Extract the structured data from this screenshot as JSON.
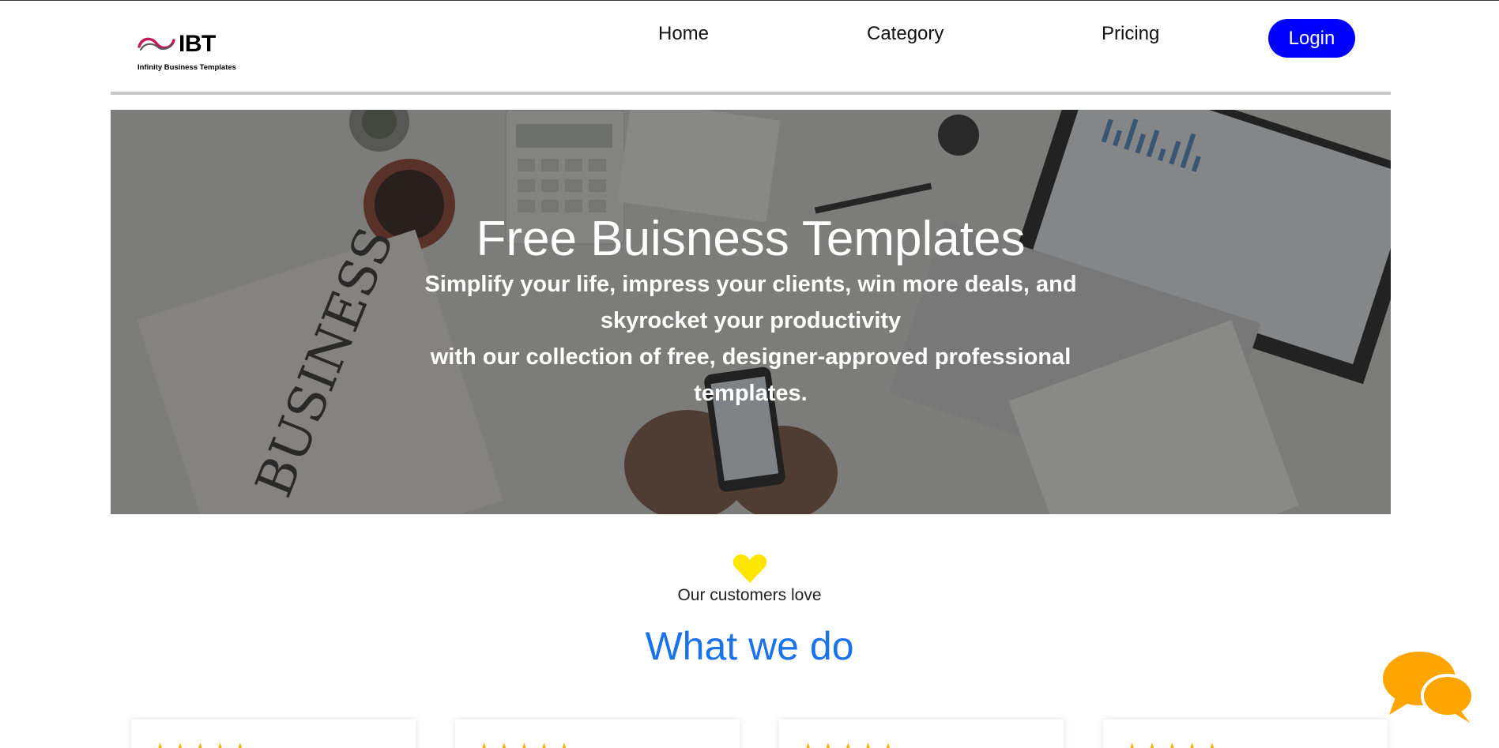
{
  "header": {
    "logo": {
      "name": "IBT",
      "tagline": "Infinity Business Templates",
      "icon": "infinity-swirl-icon"
    },
    "nav": [
      "Home",
      "Category",
      "Pricing"
    ],
    "login_label": "Login",
    "colors": {
      "login": "#0000ff",
      "divider": "#c8c8c8"
    }
  },
  "hero": {
    "title": "Free Buisness Templates",
    "subtitle_line1": "Simplify your life, impress your clients, win more deals, and skyrocket your productivity",
    "subtitle_line2": "with our collection of free, designer-approved professional templates."
  },
  "love_section": {
    "icon": "heart-icon",
    "heart_color": "#ffe600",
    "text": "Our customers love",
    "title": "What we do",
    "title_color": "#1a73e8"
  },
  "cards": [
    {
      "stars": "★★★★★"
    },
    {
      "stars": "★★★★★"
    },
    {
      "stars": "★★★★★"
    },
    {
      "stars": "★★★★★"
    }
  ],
  "chat": {
    "icon": "chat-bubbles-icon",
    "color": "#ffa500"
  }
}
